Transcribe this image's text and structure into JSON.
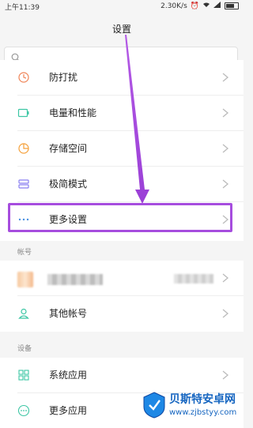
{
  "status": {
    "time": "上午11:39",
    "speed": "2.30K/s"
  },
  "header": {
    "title": "设置"
  },
  "search": {
    "placeholder": ""
  },
  "rows": [
    {
      "label": "防打扰",
      "icon": "moon-icon",
      "color": "#f08457"
    },
    {
      "label": "电量和性能",
      "icon": "battery-icon",
      "color": "#3cc6a4"
    },
    {
      "label": "存储空间",
      "icon": "storage-pie-icon",
      "color": "#f5a03a"
    },
    {
      "label": "极简模式",
      "icon": "simple-mode-icon",
      "color": "#8a7ff0"
    },
    {
      "label": "更多设置",
      "icon": "more-dots-icon",
      "color": "#4a90e2"
    }
  ],
  "account_section": {
    "title": "帐号"
  },
  "account_rows": [
    {
      "label": "其他帐号",
      "icon": "person-icon",
      "color": "#3cc6a4"
    }
  ],
  "device_section": {
    "title": "设备"
  },
  "device_rows": [
    {
      "label": "系统应用",
      "icon": "grid-icon",
      "color": "#3cc6a4"
    },
    {
      "label": "更多应用",
      "icon": "more-circle-icon",
      "color": "#3cc6a4"
    }
  ],
  "watermark": {
    "text": "贝斯特安卓网",
    "url": "www.zjbstyy.com"
  },
  "colors": {
    "highlight": "#a64dde",
    "arrow": "#a64dde"
  }
}
